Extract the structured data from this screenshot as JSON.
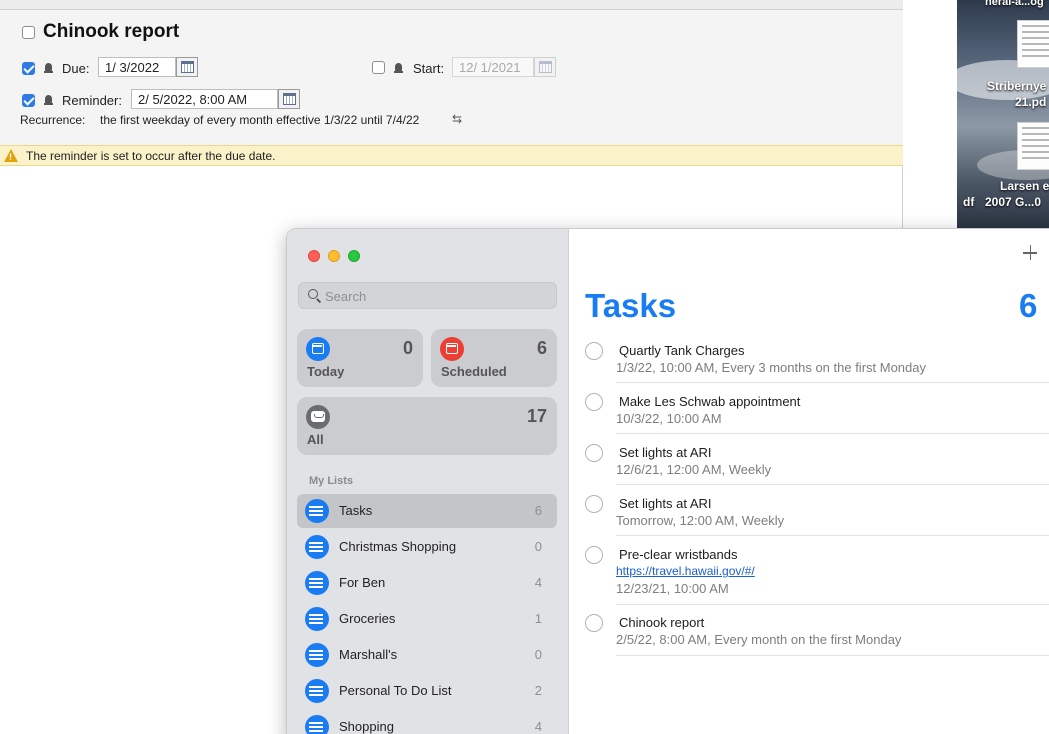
{
  "background_window": {
    "task_title": "Chinook report",
    "due": {
      "label": "Due:",
      "value": "1/  3/2022",
      "checked": true
    },
    "start": {
      "label": "Start:",
      "value": "12/  1/2021",
      "checked": false
    },
    "reminder": {
      "label": "Reminder:",
      "value": "2/  5/2022,   8:00 AM",
      "checked": true
    },
    "recurrence": {
      "label": "Recurrence:",
      "value": "the first weekday of every month effective 1/3/22 until 7/4/22"
    },
    "warning": {
      "icon": "warning-triangle-icon",
      "text": "The reminder is set to occur after the due date."
    }
  },
  "desktop": {
    "top_label": "neral-a...og",
    "file1_label_line1": "Stribernye",
    "file1_label_line2": "21.pd",
    "file2_label_line1": "Larsen e",
    "file2_label_line2": "2007 G...0",
    "file2_label_prefix": "df"
  },
  "reminders": {
    "search": {
      "placeholder": "Search"
    },
    "smart_lists": [
      {
        "name": "Today",
        "count": "0",
        "color": "#1a7cf3",
        "icon": "calendar-today-icon"
      },
      {
        "name": "Scheduled",
        "count": "6",
        "color": "#ec3e33",
        "icon": "calendar-grid-icon"
      },
      {
        "name": "All",
        "count": "17",
        "color": "#6b6c70",
        "icon": "tray-icon"
      }
    ],
    "my_lists_header": "My Lists",
    "lists": [
      {
        "name": "Tasks",
        "count": "6",
        "selected": true
      },
      {
        "name": "Christmas Shopping",
        "count": "0"
      },
      {
        "name": "For Ben",
        "count": "4"
      },
      {
        "name": "Groceries",
        "count": "1"
      },
      {
        "name": "Marshall's",
        "count": "0"
      },
      {
        "name": "Personal To Do List",
        "count": "2"
      },
      {
        "name": "Shopping",
        "count": "4"
      }
    ],
    "main": {
      "title": "Tasks",
      "count": "6",
      "accent": "#1a7cf3",
      "tasks": [
        {
          "title": "Quartly Tank Charges",
          "subtitle": "1/3/22, 10:00 AM, Every 3 months on the first Monday"
        },
        {
          "title": "Make Les Schwab appointment",
          "subtitle": "10/3/22, 10:00 AM"
        },
        {
          "title": "Set lights at ARI",
          "subtitle": "12/6/21, 12:00 AM, Weekly"
        },
        {
          "title": "Set lights at ARI",
          "subtitle": "Tomorrow, 12:00 AM, Weekly"
        },
        {
          "title": "Pre-clear wristbands",
          "link": "https://travel.hawaii.gov/#/",
          "subtitle": "12/23/21, 10:00 AM"
        },
        {
          "title": "Chinook report",
          "subtitle": "2/5/22, 8:00 AM, Every month on the first Monday"
        }
      ]
    }
  }
}
